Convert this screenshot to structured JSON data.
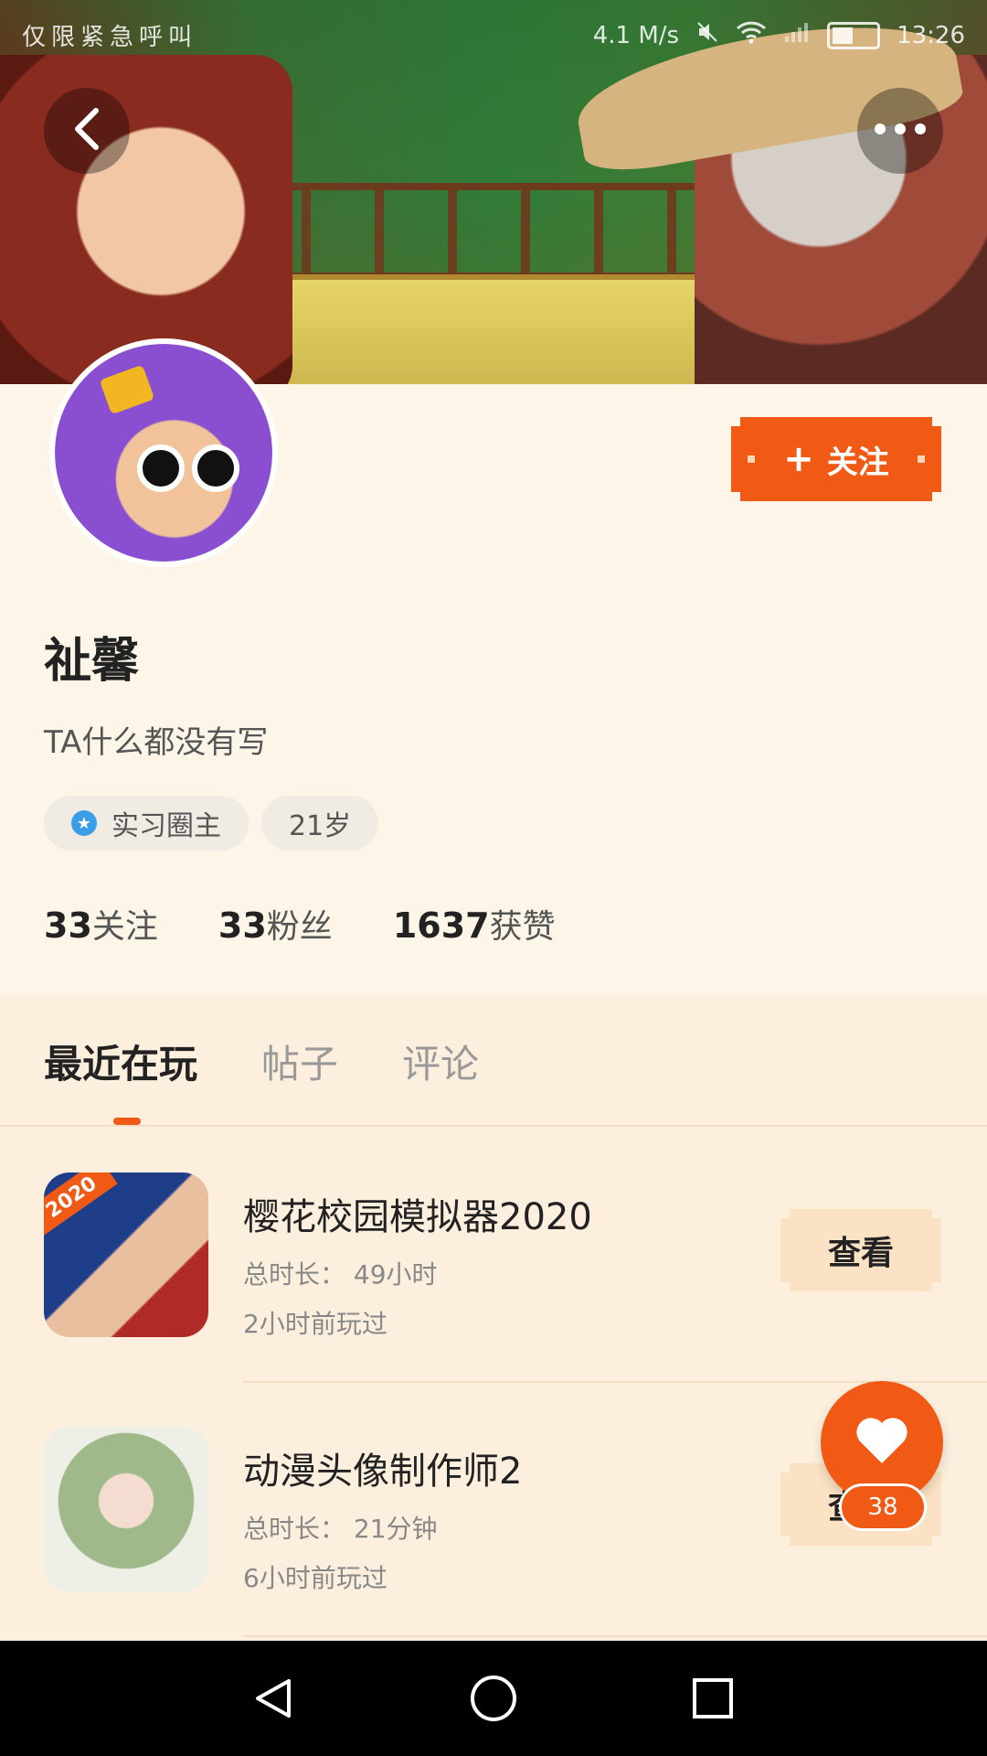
{
  "status_bar": {
    "left_text": "仅限紧急呼叫",
    "net_speed": "4.1 M/s",
    "time": "13:26"
  },
  "header": {
    "back_icon": "chevron-left-icon",
    "more_icon": "more-horizontal-icon"
  },
  "profile": {
    "name": "祉馨",
    "bio": "TA什么都没有写",
    "follow_label": "关注",
    "tags": [
      {
        "label": "实习圈主",
        "icon": "star-badge-icon"
      },
      {
        "label": "21岁"
      }
    ],
    "stats": [
      {
        "value": "33",
        "label": "关注"
      },
      {
        "value": "33",
        "label": "粉丝"
      },
      {
        "value": "1637",
        "label": "获赞"
      }
    ]
  },
  "tabs": [
    {
      "label": "最近在玩",
      "active": true
    },
    {
      "label": "帖子",
      "active": false
    },
    {
      "label": "评论",
      "active": false
    }
  ],
  "games": [
    {
      "title": "樱花校园模拟器2020",
      "icon_label": "2020",
      "duration": "总时长： 49小时",
      "last_played": "2小时前玩过",
      "button": "查看"
    },
    {
      "title": "动漫头像制作师2",
      "duration": "总时长： 21分钟",
      "last_played": "6小时前玩过",
      "button": "查看"
    }
  ],
  "like_fab": {
    "icon": "heart-icon",
    "count": "38"
  },
  "colors": {
    "accent": "#f05a14",
    "page_bg": "#fdf6e8",
    "list_bg": "#fdefde"
  }
}
